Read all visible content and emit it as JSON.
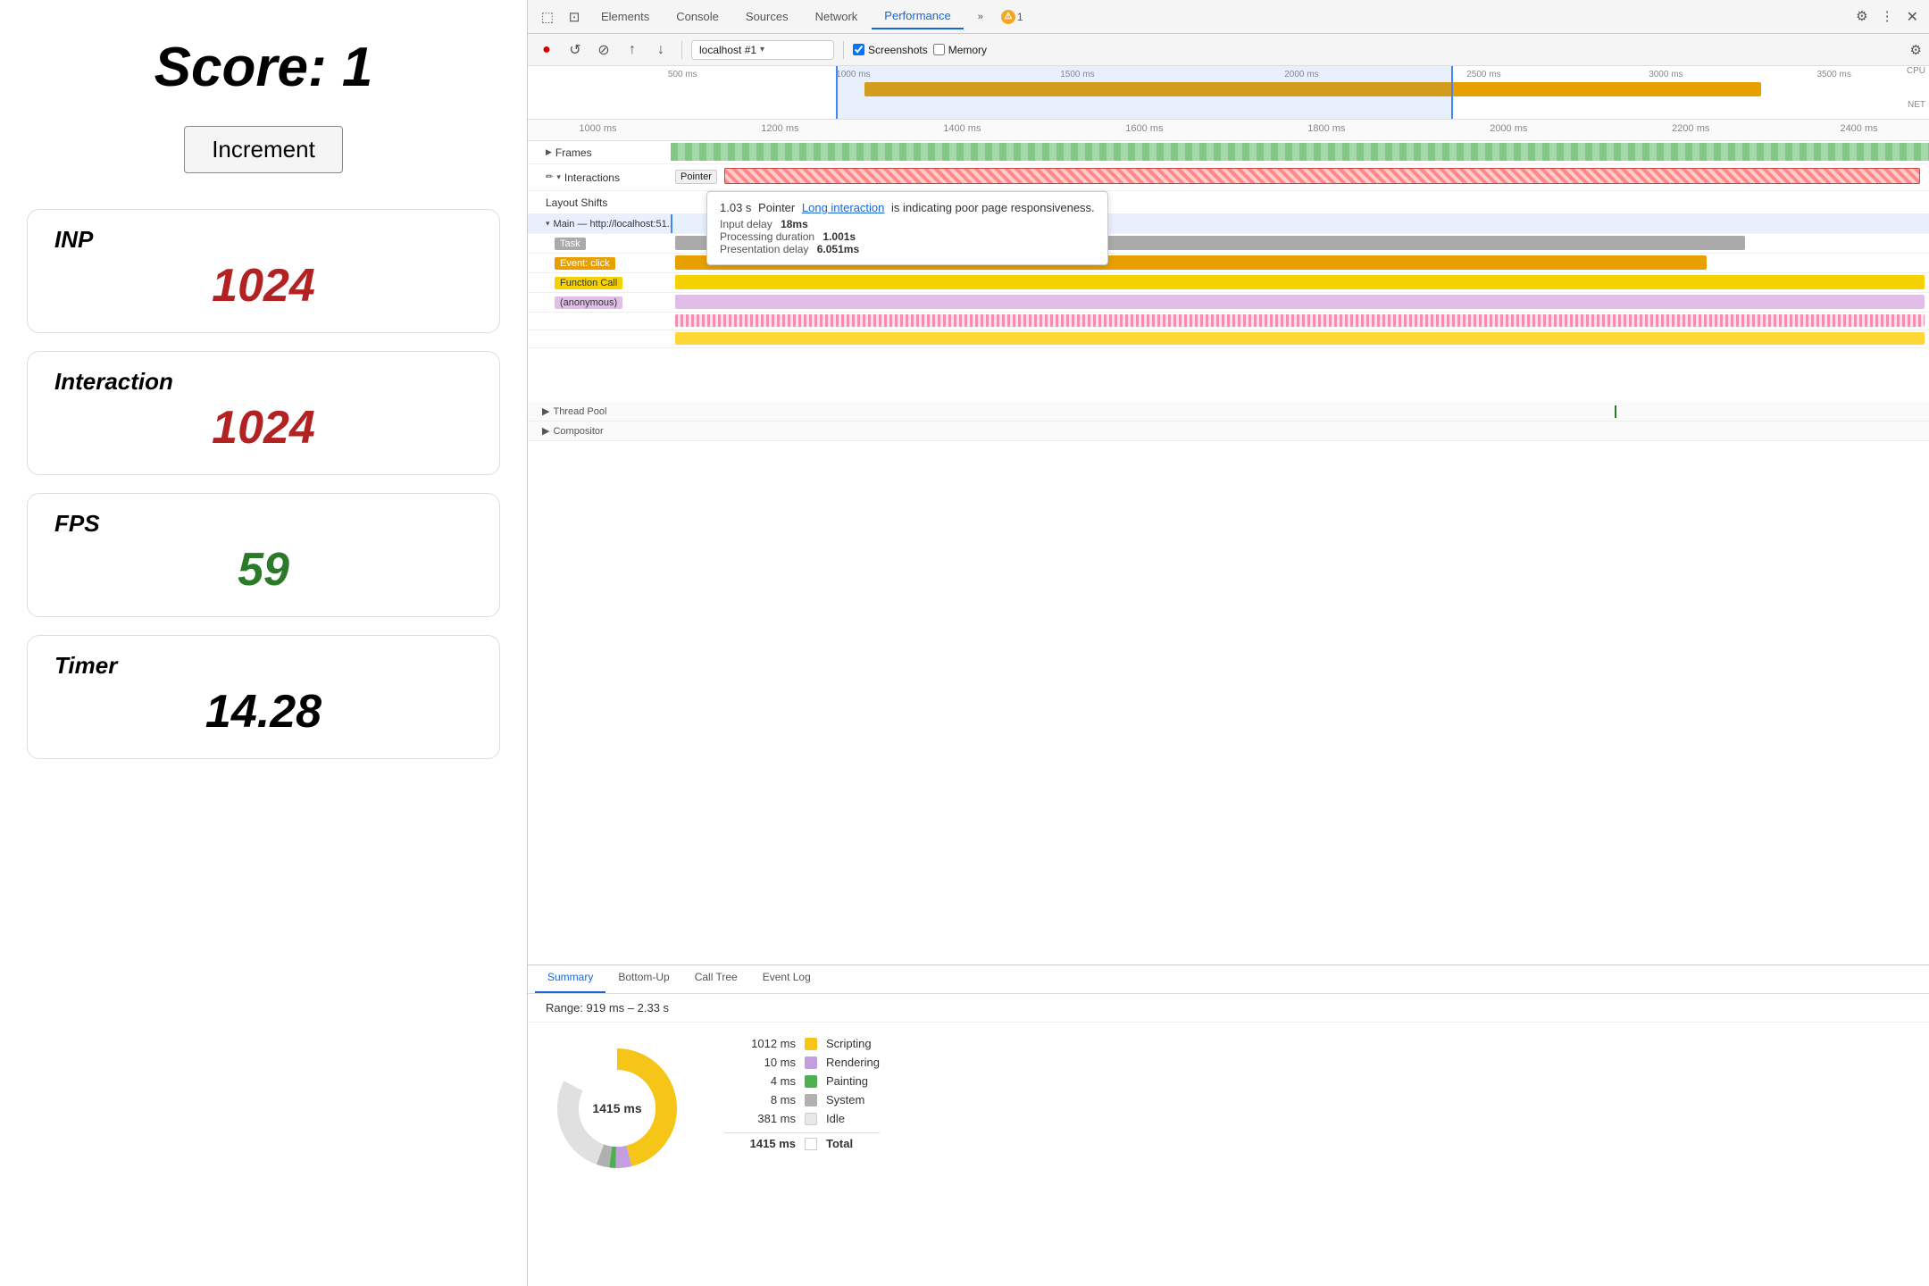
{
  "left": {
    "score_label": "Score:  1",
    "increment_button": "Increment",
    "metrics": [
      {
        "label": "INP",
        "value": "1024",
        "color": "red"
      },
      {
        "label": "Interaction",
        "value": "1024",
        "color": "red"
      },
      {
        "label": "FPS",
        "value": "59",
        "color": "green"
      },
      {
        "label": "Timer",
        "value": "14.28",
        "color": "black"
      }
    ]
  },
  "devtools": {
    "tabs": [
      {
        "label": "Elements",
        "active": false
      },
      {
        "label": "Console",
        "active": false
      },
      {
        "label": "Sources",
        "active": false
      },
      {
        "label": "Network",
        "active": false
      },
      {
        "label": "Performance",
        "active": true
      }
    ],
    "more_label": "»",
    "warning_count": "1",
    "url_value": "localhost #1",
    "screenshots_label": "Screenshots",
    "memory_label": "Memory",
    "timeline_ruler": [
      "500 ms",
      "1000 ms",
      "1500 ms",
      "2000 ms",
      "2500 ms",
      "3000 ms",
      "3500 ms"
    ],
    "cpu_label": "CPU",
    "net_label": "NET",
    "ruler2": [
      "1000 ms",
      "1200 ms",
      "1400 ms",
      "1600 ms",
      "1800 ms",
      "2000 ms",
      "2200 ms",
      "2400 ms"
    ],
    "frames_label": "Frames",
    "interactions_label": "Interactions",
    "pointer_label": "Pointer",
    "layout_shifts_label": "Layout Shifts",
    "main_label": "Main — http://localhost:51...",
    "task_label": "Task",
    "event_click_label": "Event: click",
    "function_call_label": "Function Call",
    "anonymous_label": "(anonymous)",
    "thread_pool_label": "Thread Pool",
    "compositor_label": "Compositor",
    "tooltip": {
      "time": "1.03 s",
      "event": "Pointer",
      "link_text": "Long interaction",
      "description": "is indicating poor page responsiveness.",
      "input_delay_label": "Input delay",
      "input_delay_value": "18ms",
      "processing_label": "Processing duration",
      "processing_value": "1.001s",
      "presentation_label": "Presentation delay",
      "presentation_value": "6.051ms"
    },
    "bottom_tabs": [
      "Summary",
      "Bottom-Up",
      "Call Tree",
      "Event Log"
    ],
    "range_text": "Range: 919 ms – 2.33 s",
    "donut_center": "1415 ms",
    "legend": [
      {
        "value": "1012 ms",
        "color": "#f5c518",
        "name": "Scripting"
      },
      {
        "value": "10 ms",
        "color": "#c39fe0",
        "name": "Rendering"
      },
      {
        "value": "4 ms",
        "color": "#4caf50",
        "name": "Painting"
      },
      {
        "value": "8 ms",
        "color": "#b0b0b0",
        "name": "System"
      },
      {
        "value": "381 ms",
        "color": "#e0e0e0",
        "name": "Idle"
      },
      {
        "value": "1415 ms",
        "color": null,
        "name": "Total"
      }
    ]
  }
}
